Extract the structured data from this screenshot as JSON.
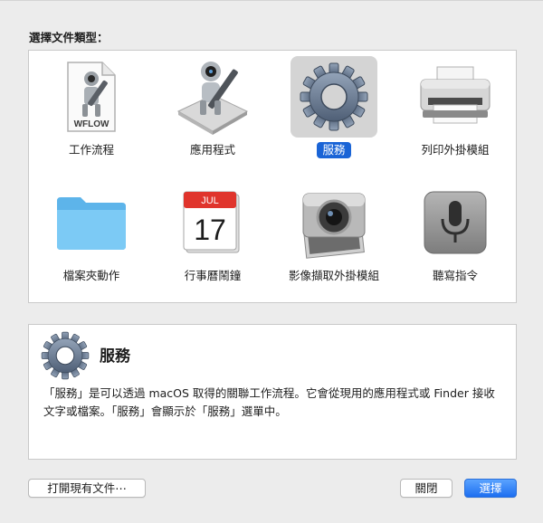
{
  "dialog": {
    "section_label": "選擇文件類型："
  },
  "types": [
    {
      "label": "工作流程",
      "icon": "workflow-file-icon",
      "badge": "WFLOW",
      "selected": false
    },
    {
      "label": "應用程式",
      "icon": "automator-robot-icon",
      "selected": false
    },
    {
      "label": "服務",
      "icon": "gear-icon",
      "selected": true
    },
    {
      "label": "列印外掛模組",
      "icon": "printer-icon",
      "selected": false
    },
    {
      "label": "檔案夾動作",
      "icon": "folder-icon",
      "selected": false
    },
    {
      "label": "行事曆鬧鐘",
      "icon": "calendar-icon",
      "month": "JUL",
      "day": "17",
      "selected": false
    },
    {
      "label": "影像擷取外掛模組",
      "icon": "camera-icon",
      "selected": false
    },
    {
      "label": "聽寫指令",
      "icon": "microphone-icon",
      "selected": false
    }
  ],
  "detail": {
    "icon": "gear-icon",
    "title": "服務",
    "description": "「服務」是可以透過 macOS 取得的關聯工作流程。它會從現用的應用程式或 Finder 接收文字或檔案。「服務」會顯示於「服務」選單中。"
  },
  "buttons": {
    "open_existing": "打開現有文件⋯",
    "close": "關閉",
    "choose": "選擇"
  },
  "colors": {
    "accent": "#1a64d6",
    "selected_tile_bg": "#d4d4d4",
    "window_bg": "#ececec"
  }
}
